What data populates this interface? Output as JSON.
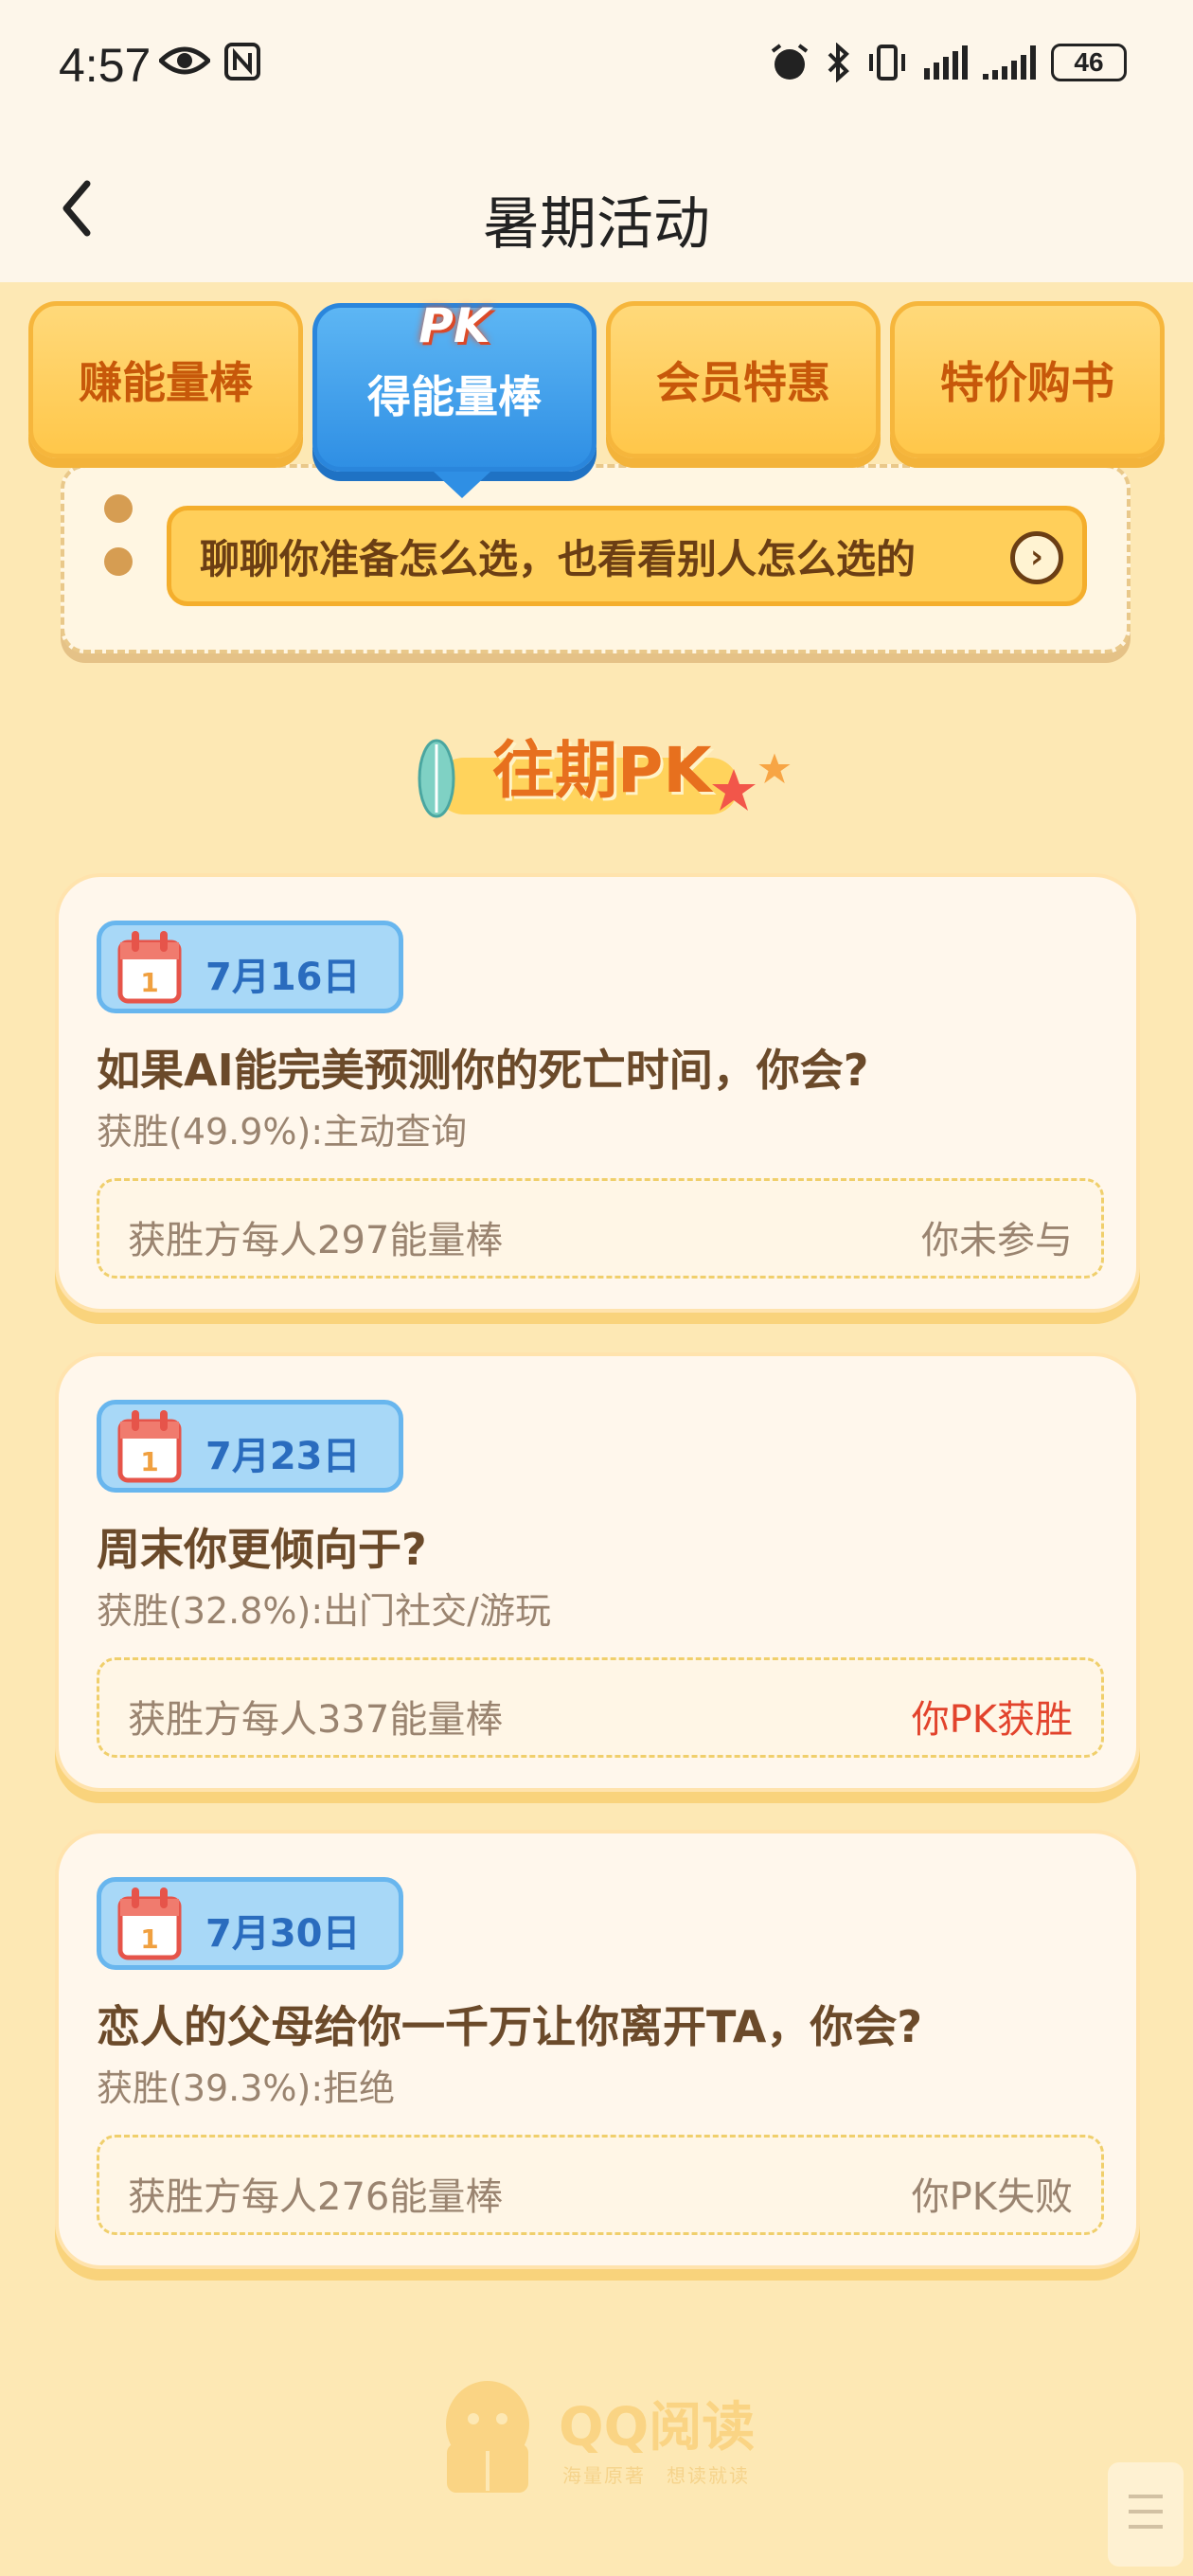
{
  "status_bar": {
    "time": "4:57",
    "battery": "46"
  },
  "header": {
    "title": "暑期活动"
  },
  "tabs": [
    {
      "label": "赚能量棒",
      "active": false
    },
    {
      "label": "得能量棒",
      "badge": "PK",
      "active": true
    },
    {
      "label": "会员特惠",
      "active": false
    },
    {
      "label": "特价购书",
      "active": false
    }
  ],
  "banner": {
    "chat_prompt": "聊聊你准备怎么选，也看看别人怎么选的",
    "arrow_glyph": "›"
  },
  "past_pk": {
    "title": "往期PK"
  },
  "cards": [
    {
      "date": "7月16日",
      "question": "如果AI能完美预测你的死亡时间，你会?",
      "winner": "获胜(49.9%):主动查询",
      "reward": "获胜方每人297能量棒",
      "result": "你未参与"
    },
    {
      "date": "7月23日",
      "question": "周末你更倾向于?",
      "winner": "获胜(32.8%):出门社交/游玩",
      "reward": "获胜方每人337能量棒",
      "result": "你PK获胜"
    },
    {
      "date": "7月30日",
      "question": "恋人的父母给你一千万让你离开TA，你会?",
      "winner": "获胜(39.3%):拒绝",
      "reward": "获胜方每人276能量棒",
      "result": "你PK失败"
    }
  ],
  "footer": {
    "brand": "QQ阅读",
    "slogan": "海量原著　想读就读"
  },
  "colors": {
    "page_bg": "#fde8b4",
    "tab_active": "#2f8fe4",
    "tab_inactive": "#ffc74a",
    "win_red": "#e2432c"
  },
  "icons": {
    "back": "chevron-left-icon",
    "calendar": "calendar-icon",
    "arrow": "arrow-right-circle-icon"
  }
}
